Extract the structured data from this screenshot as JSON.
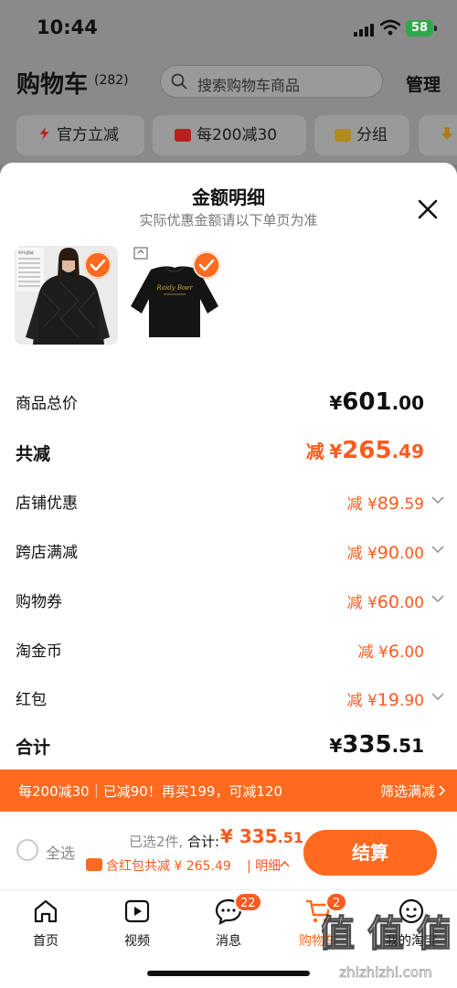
{
  "status_bar": {
    "time": "10:44",
    "battery": "58"
  },
  "background_page": {
    "title": "购物车",
    "count": "(282)",
    "search_placeholder": "搜索购物车商品",
    "manage_label": "管理",
    "chips": [
      {
        "label": "官方立减",
        "icon": "lightning-icon"
      },
      {
        "label": "每200减30",
        "icon": "coupon-icon"
      },
      {
        "label": "分组",
        "icon": "folder-icon"
      }
    ]
  },
  "sheet": {
    "title": "金额明细",
    "subtitle": "实际优惠金额请以下单页为准",
    "products": [
      {
        "name": "black down jacket (model photo)",
        "selected": true
      },
      {
        "name": "Raidy Boer black sweatshirt",
        "selected": true
      }
    ],
    "product_image_text": {
      "size_chart_header": "90%鹅绒",
      "brand": "Raidy Boer"
    },
    "rows": {
      "total_price": {
        "label": "商品总价",
        "currency": "¥",
        "int": "601",
        "dec": ".00"
      },
      "total_discount": {
        "label": "共减",
        "prefix": "减",
        "currency": "¥",
        "int": "265",
        "dec": ".49"
      },
      "shop_discount": {
        "label": "店铺优惠",
        "prefix": "减",
        "currency": "¥",
        "int": "89",
        "dec": ".59"
      },
      "cross_shop": {
        "label": "跨店满减",
        "prefix": "减",
        "currency": "¥",
        "int": "90",
        "dec": ".00"
      },
      "coupon": {
        "label": "购物券",
        "prefix": "减",
        "currency": "¥",
        "int": "60",
        "dec": ".00"
      },
      "taojin_coin": {
        "label": "淘金币",
        "prefix": "减",
        "currency": "¥",
        "int": "6",
        "dec": ".00"
      },
      "red_packet": {
        "label": "红包",
        "prefix": "减",
        "currency": "¥",
        "int": "19",
        "dec": ".90"
      },
      "subtotal": {
        "label": "合计",
        "currency": "¥",
        "int": "335",
        "dec": ".51"
      }
    },
    "promo_bar": {
      "text": "每200减30｜已减90！再买199，可减120",
      "link": "筛选满减"
    },
    "checkout": {
      "select_all": "全选",
      "selected_info": "已选2件,",
      "total_label": "合计:",
      "total_currency": "¥",
      "total_int": "335",
      "total_dec": ".51",
      "hongbao_text": "含红包共减 ¥ 265.49",
      "detail_link": "明细",
      "button": "结算"
    }
  },
  "tabbar": [
    {
      "label": "首页",
      "icon": "home-icon",
      "badge": ""
    },
    {
      "label": "视频",
      "icon": "video-icon",
      "badge": ""
    },
    {
      "label": "消息",
      "icon": "message-icon",
      "badge": "22"
    },
    {
      "label": "购物车",
      "icon": "cart-icon",
      "badge": "2",
      "active": true
    },
    {
      "label": "我的淘宝",
      "icon": "profile-icon",
      "badge": ""
    }
  ],
  "watermark": {
    "text": "值 值 值",
    "site": "zhizhizhi.com"
  },
  "colors": {
    "accent": "#ff6a1f",
    "discount_text": "#ff5a1f",
    "overlay": "#8a8a8a"
  }
}
